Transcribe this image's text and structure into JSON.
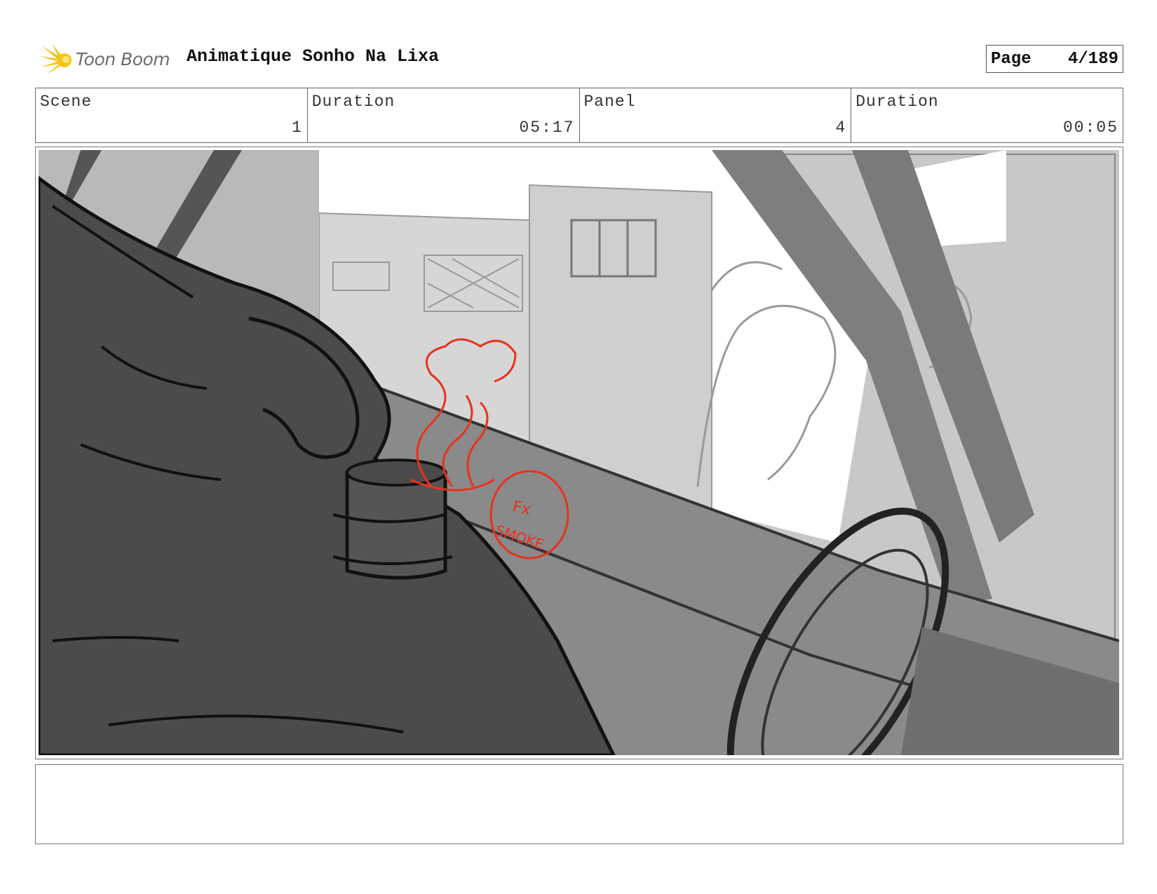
{
  "header": {
    "logo_text": "Toon Boom",
    "project_title": "Animatique Sonho Na Lixa",
    "page_label": "Page",
    "page_value": "4/189"
  },
  "info": {
    "scene_label": "Scene",
    "scene_value": "1",
    "scene_duration_label": "Duration",
    "scene_duration_value": "05:17",
    "panel_label": "Panel",
    "panel_value": "4",
    "panel_duration_label": "Duration",
    "panel_duration_value": "00:05"
  },
  "colors": {
    "logo_yellow": "#f5c518",
    "sketch_red": "#e8321e",
    "sketch_dark": "#4a4a4a",
    "sketch_light": "#c8c8c8"
  },
  "sketch": {
    "fx_line1": "Fx",
    "fx_line2": "SMOKE"
  },
  "notes": {
    "text": ""
  }
}
